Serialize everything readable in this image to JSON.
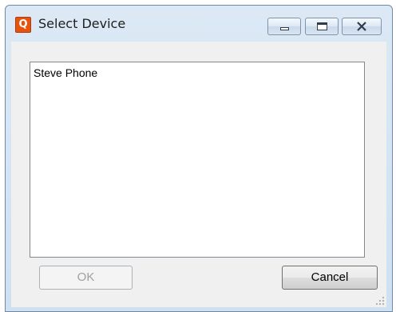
{
  "window": {
    "title": "Select Device",
    "app_icon_letter": "Q"
  },
  "devices": [
    {
      "name": "Steve Phone"
    }
  ],
  "buttons": {
    "ok_label": "OK",
    "cancel_label": "Cancel"
  },
  "colors": {
    "app_icon": "#e8520f",
    "titlebar": "#cfe0f1",
    "dialog_background": "#f0f0f0"
  }
}
